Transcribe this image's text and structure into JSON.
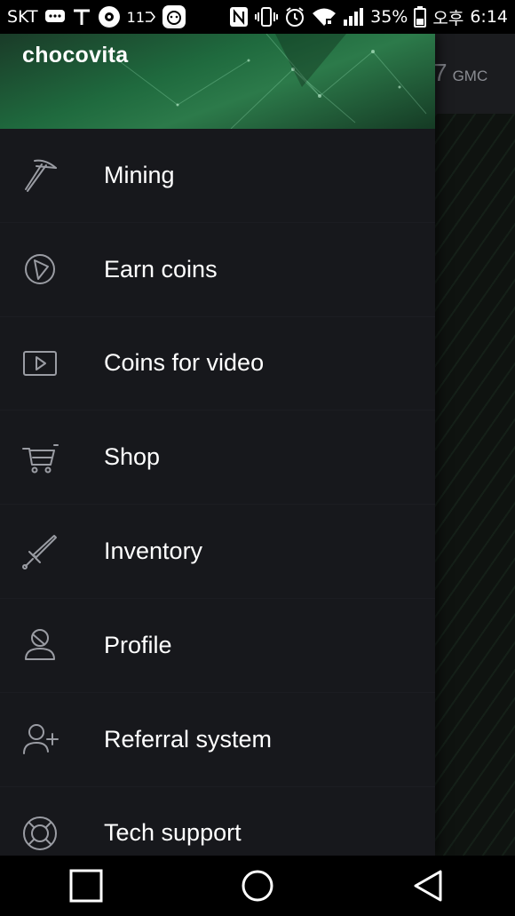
{
  "status_bar": {
    "carrier": "SKT",
    "carrier2": "11",
    "battery": "35%",
    "time_period": "오후",
    "time": "6:14"
  },
  "background": {
    "balance": "7",
    "unit": "GMC"
  },
  "drawer": {
    "username": "chocovita",
    "items": [
      {
        "label": "Mining",
        "icon": "pickaxe-icon"
      },
      {
        "label": "Earn coins",
        "icon": "play-circle-icon"
      },
      {
        "label": "Coins for video",
        "icon": "video-icon"
      },
      {
        "label": "Shop",
        "icon": "cart-icon"
      },
      {
        "label": "Inventory",
        "icon": "sword-icon"
      },
      {
        "label": "Profile",
        "icon": "user-icon"
      },
      {
        "label": "Referral system",
        "icon": "add-user-icon"
      },
      {
        "label": "Tech support",
        "icon": "lifebuoy-icon"
      }
    ]
  },
  "nav_bar": {
    "buttons": [
      "recent-apps",
      "home",
      "back"
    ]
  },
  "colors": {
    "drawer_bg": "#17181c",
    "header_green": "#1f6a3e",
    "icon_gray": "#9a9ca3",
    "text": "#ffffff"
  }
}
